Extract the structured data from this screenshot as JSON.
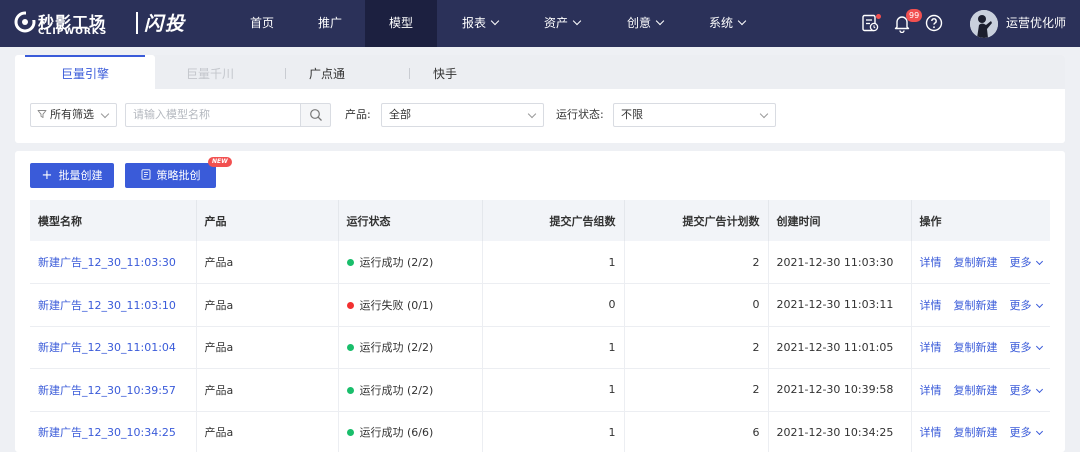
{
  "colors": {
    "nav_bg": "#2b3159",
    "nav_active": "#1c2040",
    "accent": "#3a5bd9",
    "success": "#19be6b",
    "error": "#f23030",
    "badge": "#f25050"
  },
  "brand": {
    "name_cn": "秒影工场",
    "name_en": "CLIPWORKS",
    "product": "闪投"
  },
  "nav": {
    "items": [
      {
        "label": "首页",
        "has_dropdown": false
      },
      {
        "label": "推广",
        "has_dropdown": false
      },
      {
        "label": "模型",
        "has_dropdown": false,
        "active": true
      },
      {
        "label": "报表",
        "has_dropdown": true
      },
      {
        "label": "资产",
        "has_dropdown": true
      },
      {
        "label": "创意",
        "has_dropdown": true
      },
      {
        "label": "系统",
        "has_dropdown": true
      }
    ],
    "notification_count": "99",
    "icons": [
      "task-list-icon",
      "bell-icon",
      "help-icon"
    ],
    "username": "运营优化师"
  },
  "tabs": [
    {
      "label": "巨量引擎",
      "state": "active"
    },
    {
      "label": "巨量千川",
      "state": "disabled"
    },
    {
      "label": "广点通",
      "state": "normal"
    },
    {
      "label": "快手",
      "state": "normal"
    }
  ],
  "filters": {
    "all_filter_label": "所有筛选",
    "search_placeholder": "请输入模型名称",
    "product_label": "产品:",
    "product_value": "全部",
    "status_label": "运行状态:",
    "status_value": "不限"
  },
  "actions": {
    "batch_create": "批量创建",
    "strategy_batch": "策略批创",
    "new_tag": "NEW"
  },
  "table": {
    "columns": [
      "模型名称",
      "产品",
      "运行状态",
      "提交广告组数",
      "提交广告计划数",
      "创建时间",
      "操作"
    ],
    "rows": [
      {
        "name": "新建广告_12_30_11:03:30",
        "product": "产品a",
        "status": "运行成功 (2/2)",
        "status_type": "success",
        "groups": "1",
        "plans": "2",
        "created": "2021-12-30 11:03:30"
      },
      {
        "name": "新建广告_12_30_11:03:10",
        "product": "产品a",
        "status": "运行失败 (0/1)",
        "status_type": "error",
        "groups": "0",
        "plans": "0",
        "created": "2021-12-30 11:03:11"
      },
      {
        "name": "新建广告_12_30_11:01:04",
        "product": "产品a",
        "status": "运行成功 (2/2)",
        "status_type": "success",
        "groups": "1",
        "plans": "2",
        "created": "2021-12-30 11:01:05"
      },
      {
        "name": "新建广告_12_30_10:39:57",
        "product": "产品a",
        "status": "运行成功 (2/2)",
        "status_type": "success",
        "groups": "1",
        "plans": "2",
        "created": "2021-12-30 10:39:58"
      },
      {
        "name": "新建广告_12_30_10:34:25",
        "product": "产品a",
        "status": "运行成功 (6/6)",
        "status_type": "success",
        "groups": "1",
        "plans": "6",
        "created": "2021-12-30 10:34:25"
      }
    ],
    "row_actions": {
      "detail": "详情",
      "copy_new": "复制新建",
      "more": "更多"
    }
  }
}
